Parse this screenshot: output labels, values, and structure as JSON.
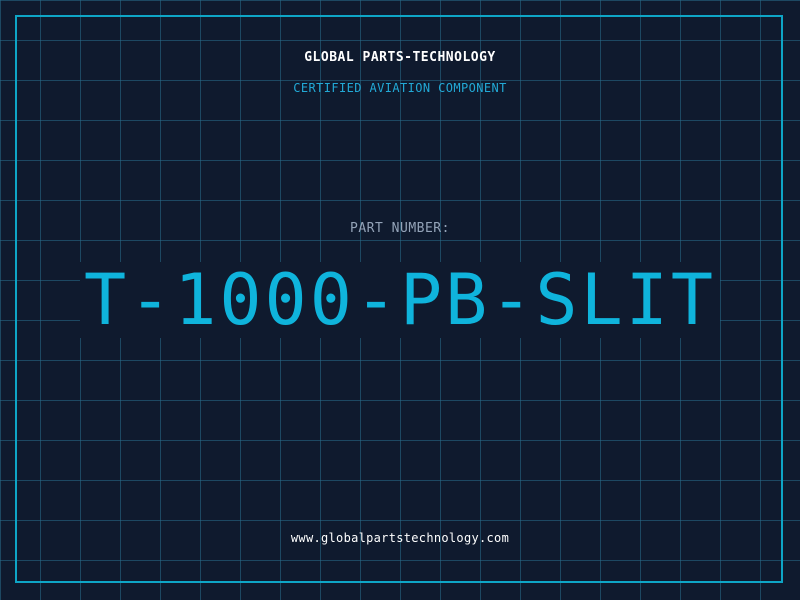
{
  "header": {
    "company": "GLOBAL PARTS-TECHNOLOGY",
    "tagline": "CERTIFIED AVIATION COMPONENT"
  },
  "part": {
    "label": "PART NUMBER:",
    "number": "T-1000-PB-SLIT"
  },
  "footer": {
    "website": "www.globalpartstechnology.com"
  },
  "colors": {
    "background": "#0f1a2e",
    "grid": "#286e8c",
    "frame": "#0ea5c6",
    "accent": "#0fb4dc",
    "text": "#ffffff",
    "muted": "#94a3b8"
  }
}
